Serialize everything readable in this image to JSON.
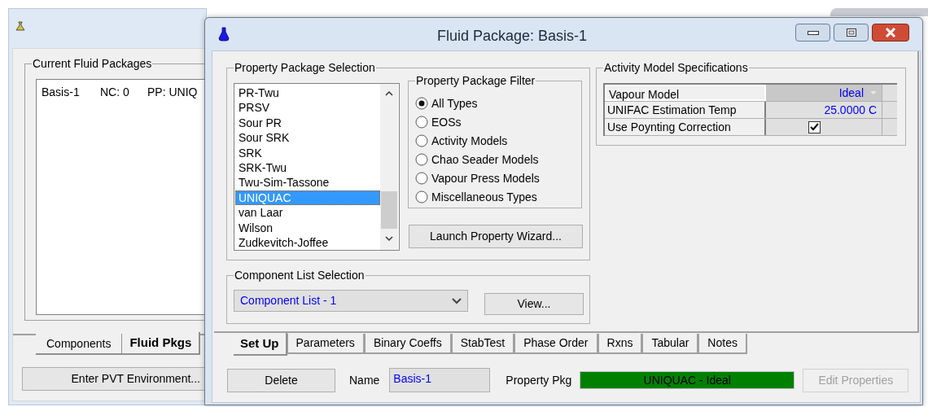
{
  "back_window": {
    "group_title": "Current Fluid Packages",
    "packages": [
      {
        "cells": [
          "Basis-1",
          "NC: 0",
          "PP: UNIQ"
        ]
      }
    ],
    "tabs": [
      {
        "label": "Components",
        "selected": false
      },
      {
        "label": "Fluid Pkgs",
        "selected": true
      }
    ],
    "button": "Enter PVT Environment..."
  },
  "window": {
    "title": "Fluid Package: Basis-1"
  },
  "property_package_selection": {
    "title": "Property Package Selection",
    "items": [
      {
        "label": "PR-Twu",
        "selected": false
      },
      {
        "label": "PRSV",
        "selected": false
      },
      {
        "label": "Sour PR",
        "selected": false
      },
      {
        "label": "Sour SRK",
        "selected": false
      },
      {
        "label": "SRK",
        "selected": false
      },
      {
        "label": "SRK-Twu",
        "selected": false
      },
      {
        "label": "Twu-Sim-Tassone",
        "selected": false
      },
      {
        "label": "UNIQUAC",
        "selected": true
      },
      {
        "label": "van Laar",
        "selected": false
      },
      {
        "label": "Wilson",
        "selected": false
      },
      {
        "label": "Zudkevitch-Joffee",
        "selected": false
      }
    ],
    "filter": {
      "title": "Property Package Filter",
      "options": [
        {
          "label": "All Types",
          "selected": true
        },
        {
          "label": "EOSs",
          "selected": false
        },
        {
          "label": "Activity Models",
          "selected": false
        },
        {
          "label": "Chao Seader Models",
          "selected": false
        },
        {
          "label": "Vapour Press Models",
          "selected": false
        },
        {
          "label": "Miscellaneous Types",
          "selected": false
        }
      ]
    },
    "wizard_button": "Launch Property Wizard..."
  },
  "component_list_selection": {
    "title": "Component List Selection",
    "value": "Component List - 1",
    "view_button": "View..."
  },
  "activity_model_specifications": {
    "title": "Activity Model Specifications",
    "rows": [
      {
        "label": "Vapour Model",
        "kind": "dropdown",
        "value": "Ideal"
      },
      {
        "label": "UNIFAC Estimation Temp",
        "kind": "value",
        "value": "25.0000 C"
      },
      {
        "label": "Use Poynting Correction",
        "kind": "checkbox",
        "checked": true
      }
    ]
  },
  "tabs": [
    {
      "label": "Set Up",
      "selected": true
    },
    {
      "label": "Parameters",
      "selected": false
    },
    {
      "label": "Binary Coeffs",
      "selected": false
    },
    {
      "label": "StabTest",
      "selected": false
    },
    {
      "label": "Phase Order",
      "selected": false
    },
    {
      "label": "Rxns",
      "selected": false
    },
    {
      "label": "Tabular",
      "selected": false
    },
    {
      "label": "Notes",
      "selected": false
    }
  ],
  "footer": {
    "delete_button": "Delete",
    "name_label": "Name",
    "name_value": "Basis-1",
    "property_pkg_label": "Property Pkg",
    "property_pkg_value": "UNIQUAC - Ideal",
    "edit_button": {
      "label": "Edit Properties",
      "disabled": true
    }
  }
}
